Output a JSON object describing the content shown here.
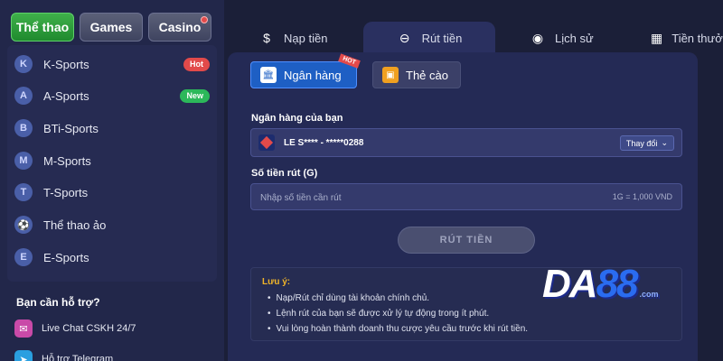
{
  "top_tabs": [
    {
      "label": "Thể thao",
      "active": true
    },
    {
      "label": "Games",
      "active": false
    },
    {
      "label": "Casino",
      "active": false
    }
  ],
  "sports": [
    {
      "label": "K-Sports",
      "icon": "k-sports-icon",
      "badge": "Hot"
    },
    {
      "label": "A-Sports",
      "icon": "a-sports-icon",
      "badge": "New"
    },
    {
      "label": "BTi-Sports",
      "icon": "bti-sports-icon",
      "badge": ""
    },
    {
      "label": "M-Sports",
      "icon": "m-sports-icon",
      "badge": ""
    },
    {
      "label": "T-Sports",
      "icon": "t-sports-icon",
      "badge": ""
    },
    {
      "label": "Thể thao ảo",
      "icon": "virtual-sports-icon",
      "badge": ""
    },
    {
      "label": "E-Sports",
      "icon": "e-sports-icon",
      "badge": ""
    }
  ],
  "help": {
    "title": "Bạn cần hỗ trợ?",
    "items": [
      {
        "label": "Live Chat CSKH 24/7",
        "icon": "chat-icon"
      },
      {
        "label": "Hỗ trợ Telegram",
        "icon": "telegram-icon"
      }
    ]
  },
  "main_tabs": [
    {
      "label": "Nạp tiền",
      "icon": "deposit-icon",
      "active": false
    },
    {
      "label": "Rút tiền",
      "icon": "withdraw-icon",
      "active": true
    },
    {
      "label": "Lịch sử",
      "icon": "history-icon",
      "active": false
    },
    {
      "label": "Tiền thưởng",
      "icon": "gift-icon",
      "active": false
    }
  ],
  "methods": {
    "bank_label": "Ngân hàng",
    "bank_hot": "HOT",
    "card_label": "Thẻ cào"
  },
  "form": {
    "bank_field_label": "Ngân hàng của bạn",
    "bank_account": "LE S**** - *****0288",
    "change_label": "Thay đổi",
    "amount_label": "Số tiền rút (G)",
    "amount_placeholder": "Nhập số tiền cần rút",
    "amount_value": "",
    "rate": "1G = 1,000 VND",
    "submit_label": "RÚT TIỀN"
  },
  "notes": {
    "title": "Lưu ý:",
    "lines": [
      "Nạp/Rút chỉ dùng tài khoản chính chủ.",
      "Lệnh rút của bạn sẽ được xử lý tự động trong ít phút.",
      "Vui lòng hoàn thành doanh thu cược yêu cầu trước khi rút tiền."
    ]
  },
  "brand": {
    "letters": "DA",
    "number": "88",
    "suffix": ".com"
  },
  "colors": {
    "accent": "#1e5fc4",
    "active_green": "#2f9e3c",
    "hot": "#e24a4a",
    "new": "#2cb85a",
    "note_title": "#f0b429"
  }
}
